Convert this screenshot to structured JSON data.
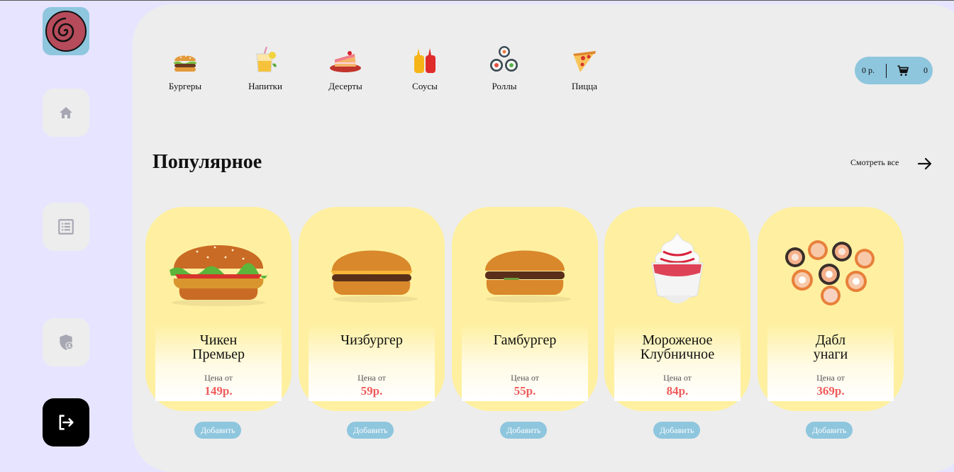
{
  "categories": [
    {
      "label": "Бургеры",
      "icon": "burger-icon"
    },
    {
      "label": "Напитки",
      "icon": "drink-icon"
    },
    {
      "label": "Десерты",
      "icon": "cake-icon"
    },
    {
      "label": "Соусы",
      "icon": "sauce-icon"
    },
    {
      "label": "Роллы",
      "icon": "rolls-icon"
    },
    {
      "label": "Пицца",
      "icon": "pizza-icon"
    }
  ],
  "cart": {
    "total": "0 р.",
    "count": "0"
  },
  "section": {
    "title": "Популярное",
    "see_all": "Смотреть все"
  },
  "products": [
    {
      "name_line1": "Чикен",
      "name_line2": "Премьер",
      "price_from": "Цена от",
      "price": "149р.",
      "add_label": "Добавить"
    },
    {
      "name_line1": "Чизбургер",
      "name_line2": "",
      "price_from": "Цена от",
      "price": "59р.",
      "add_label": "Добавить"
    },
    {
      "name_line1": "Гамбургер",
      "name_line2": "",
      "price_from": "Цена от",
      "price": "55р.",
      "add_label": "Добавить"
    },
    {
      "name_line1": "Мороженое",
      "name_line2": "Клубничное",
      "price_from": "Цена от",
      "price": "84р.",
      "add_label": "Добавить"
    },
    {
      "name_line1": "Дабл",
      "name_line2": "унаги",
      "price_from": "Цена от",
      "price": "369р.",
      "add_label": "Добавить"
    }
  ],
  "colors": {
    "accent": "#8ec6de",
    "price": "#f05a5a",
    "card": "#fef0a0",
    "panel": "#ededed",
    "background": "#e7e4ff"
  },
  "sidebar": {
    "items": [
      "home-icon",
      "list-icon",
      "user-shield-icon",
      "logout-icon"
    ]
  }
}
